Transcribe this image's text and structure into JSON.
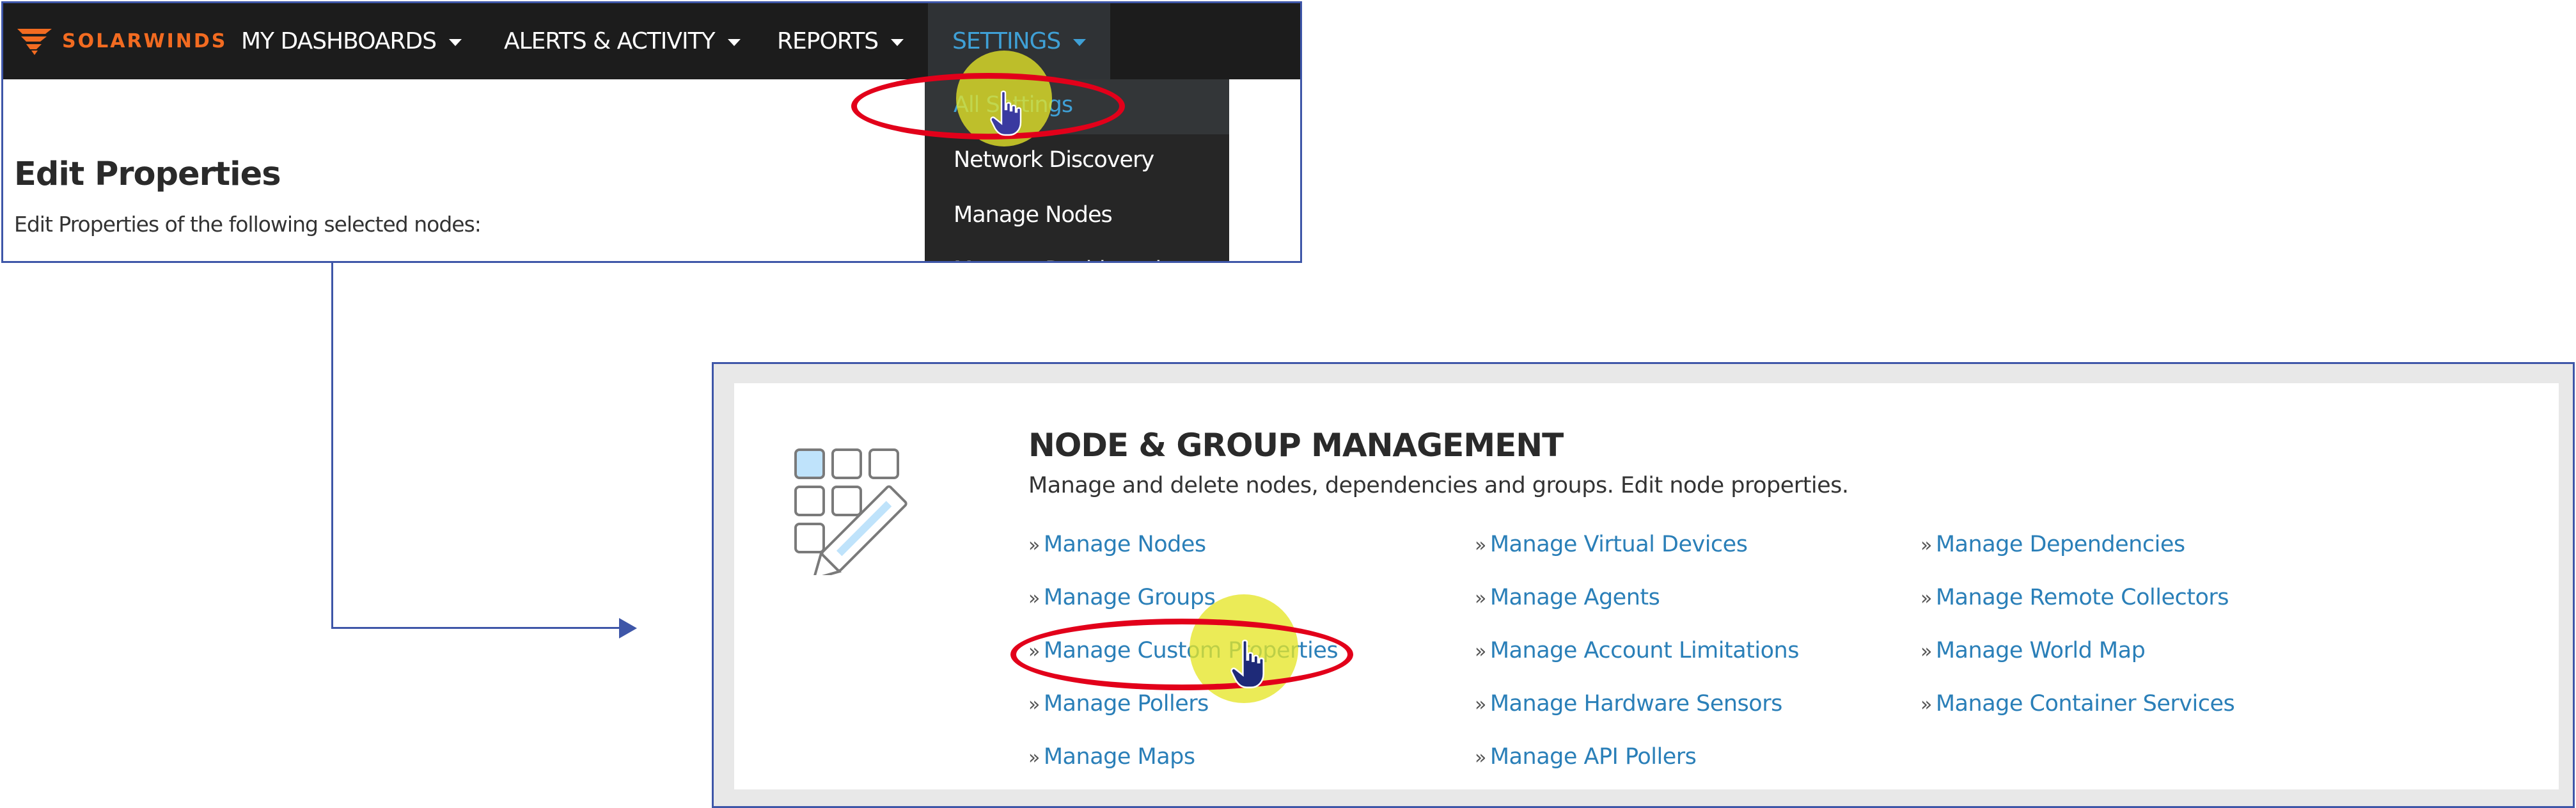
{
  "top_panel": {
    "logo_text": "SOLARWINDS",
    "nav": [
      {
        "label": "MY DASHBOARDS"
      },
      {
        "label": "ALERTS & ACTIVITY"
      },
      {
        "label": "REPORTS"
      },
      {
        "label": "SETTINGS"
      }
    ],
    "dropdown": [
      "All Settings",
      "Network Discovery",
      "Manage Nodes",
      "Manage Dashboards"
    ],
    "page_title": "Edit Properties",
    "page_subtitle": "Edit Properties of the following selected nodes:"
  },
  "bottom_panel": {
    "title": "NODE & GROUP MANAGEMENT",
    "description": "Manage and delete nodes, dependencies and groups. Edit node properties.",
    "bullet": "»",
    "links_col1": [
      "Manage Nodes",
      "Manage Groups",
      "Manage Custom Properties",
      "Manage Pollers",
      "Manage Maps"
    ],
    "links_col2": [
      "Manage Virtual Devices",
      "Manage Agents",
      "Manage Account Limitations",
      "Manage Hardware Sensors",
      "Manage API Pollers"
    ],
    "links_col3": [
      "Manage Dependencies",
      "Manage Remote Collectors",
      "Manage World Map",
      "Manage Container Services"
    ]
  },
  "colors": {
    "nav_bg": "#1c1c1c",
    "accent_blue": "#3fa0d6",
    "link_blue": "#2a7fb8",
    "brand_orange": "#f26b21",
    "frame_blue": "#3e56a8",
    "annotation_red": "#e2001a",
    "cursor_highlight": "#e6e628"
  }
}
